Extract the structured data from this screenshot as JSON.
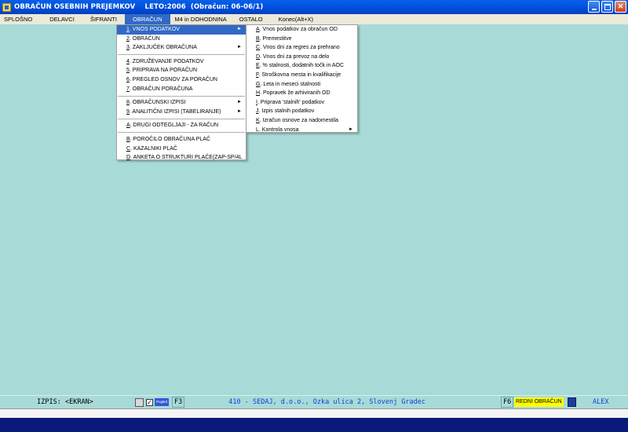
{
  "window": {
    "title": "OBRAČUN OSEBNIH PREJEMKOV    LETO:2006  (Obračun: 06-06/1)",
    "minimize_label": "_",
    "maximize_label": "□",
    "close_label": "✕"
  },
  "menubar": {
    "items": [
      {
        "label": "SPLOŠNO"
      },
      {
        "label": "DELAVCI"
      },
      {
        "label": "ŠIFRANTI"
      },
      {
        "label": "OBRAČUN"
      },
      {
        "label": "M4 in DOHODNINA"
      },
      {
        "label": "OSTALO"
      },
      {
        "label": "Konec(Alt+X)"
      }
    ]
  },
  "obracun_menu": {
    "items": [
      {
        "key": "1",
        "label": ". VNOS PODATKOV"
      },
      {
        "key": "2",
        "label": ". OBRAČUN"
      },
      {
        "key": "3",
        "label": ". ZAKLJUČEK OBRAČUNA"
      },
      {
        "key": "4",
        "label": ". ZDRUŽEVANJE PODATKOV"
      },
      {
        "key": "5",
        "label": ". PRIPRAVA NA PORAČUN"
      },
      {
        "key": "6",
        "label": ". PREGLED OSNOV ZA PORAČUN"
      },
      {
        "key": "7",
        "label": ". OBRAČUN PORAČUNA"
      },
      {
        "key": "8",
        "label": ". OBRAČUNSKI IZPISI"
      },
      {
        "key": "9",
        "label": ". ANALITIČNI IZPISI (TABELIRANJE)"
      },
      {
        "key": "A",
        "label": ". DRUGI ODTEGLJAJI - ZA RAČUN"
      },
      {
        "key": "B",
        "label": ". POROČILO OBRAČUNA PLAČ"
      },
      {
        "key": "C",
        "label": ". KAZALNIKI PLAČ"
      },
      {
        "key": "D",
        "label": ". ANKETA O STRUKTURI PLAČE(ZAP-SP/4L"
      }
    ]
  },
  "vnos_submenu": {
    "items": [
      {
        "key": "A",
        "label": ". Vnos podatkov za obračun OD"
      },
      {
        "key": "B",
        "label": ". Premestitve"
      },
      {
        "key": "C",
        "label": ". Vnos dni za regres za prehrano"
      },
      {
        "key": "D",
        "label": ". Vnos dni za prevoz na delo"
      },
      {
        "key": "E",
        "label": ". % stalnosti, dodatnih točk in AOC"
      },
      {
        "key": "F",
        "label": ". Stroškovna mesta in kvalifikacije"
      },
      {
        "key": "G",
        "label": ". Leta in meseci stalnosti"
      },
      {
        "key": "H",
        "label": ". Popravek že arhiviranih OD"
      },
      {
        "key": "I",
        "label": ". Priprava 'stalnih' podatkov"
      },
      {
        "key": "J",
        "label": ". Izpis stalnih podatkov"
      },
      {
        "key": "K",
        "label": ". Izračun osnove za nadomestila"
      },
      {
        "key": "L",
        "label": ". Kontrola vnosa"
      }
    ]
  },
  "statusbar": {
    "izpis": "IZPIS: <EKRAN>",
    "pogled": "Pogled",
    "f3": "F3",
    "company": "410 - SEDAJ, d.o.o., Ozka ulica 2, Slovenj Gradec",
    "f6": "F6",
    "mode": "REDNI OBRAČUN",
    "user": "ALEX",
    "check": "✓"
  },
  "colors": {
    "desktop_bg": "#a8dad8",
    "menu_highlight": "#316ac5",
    "mode_badge": "#ffff00",
    "bottom_bar": "#0a1a7a"
  }
}
